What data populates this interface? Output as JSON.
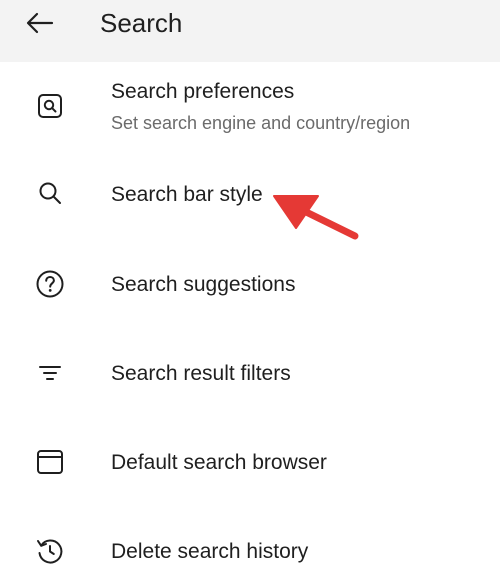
{
  "header": {
    "title": "Search",
    "back_icon": "arrow-left-icon"
  },
  "items": [
    {
      "label": "Search preferences",
      "subtitle": "Set search engine and country/region",
      "icon": "search-square-icon"
    },
    {
      "label": "Search bar style",
      "icon": "magnifier-icon"
    },
    {
      "label": "Search suggestions",
      "icon": "question-circle-icon"
    },
    {
      "label": "Search result filters",
      "icon": "filter-lines-icon"
    },
    {
      "label": "Default search browser",
      "icon": "browser-window-icon"
    },
    {
      "label": "Delete search history",
      "icon": "history-icon"
    }
  ],
  "annotation": {
    "color": "#e53935",
    "target": "Search bar style"
  }
}
